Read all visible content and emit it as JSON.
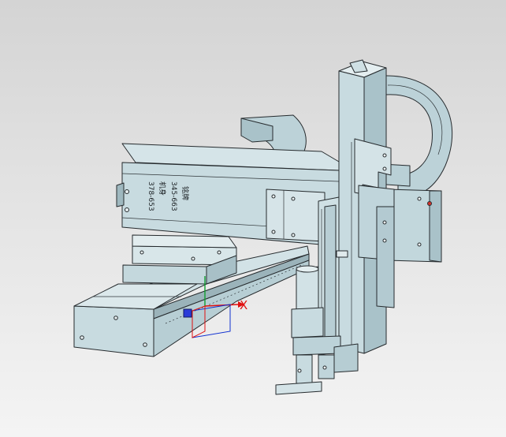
{
  "viewport": {
    "background_top": "#d4d4d4",
    "background_bottom": "#f4f4f4"
  },
  "model": {
    "body_color": "#c8dbe0",
    "shade_color": "#a9c2c9",
    "dark_color": "#7f9aa2",
    "edge_color": "#262b2e",
    "nameplate_lines": [
      "铭牌",
      "345-663",
      "机身",
      "378-653"
    ]
  },
  "triad": {
    "x_label": "X",
    "x_color": "#e01010",
    "y_color": "#10a030",
    "z_color": "#1030d0"
  }
}
